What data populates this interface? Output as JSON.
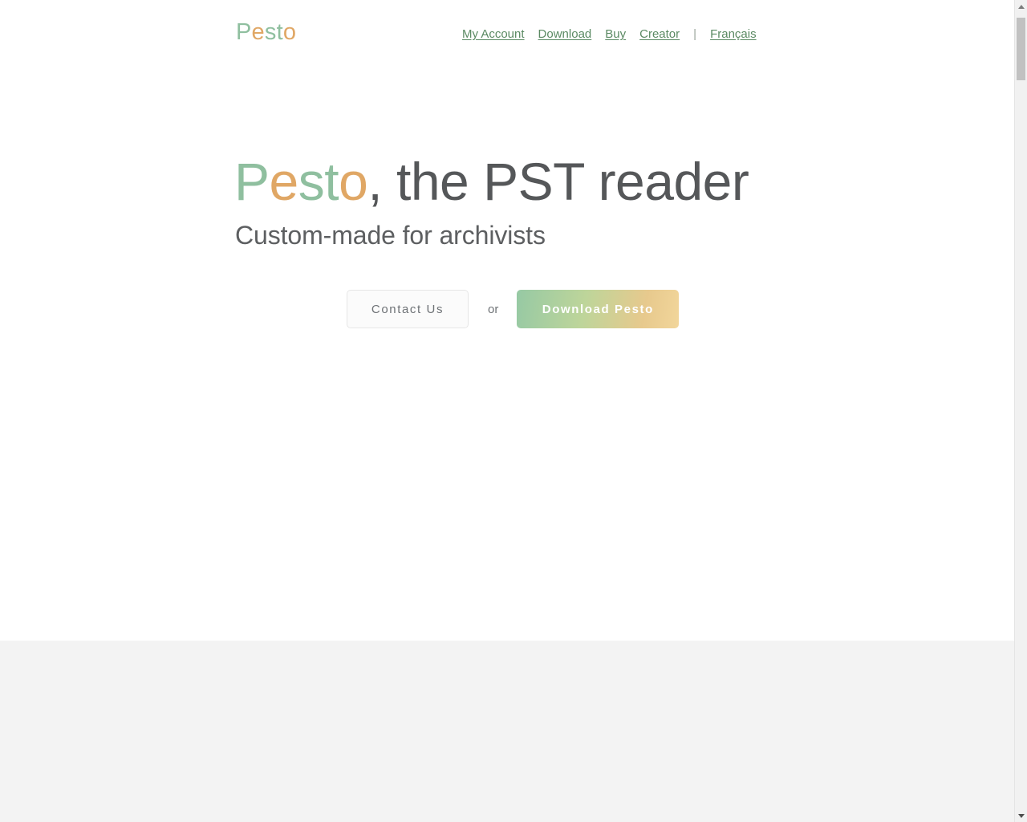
{
  "page": {
    "background_color": "#ffffff",
    "accent_green": "#8fbf9f",
    "accent_orange": "#e0a765",
    "link_green": "#5b8a63",
    "heading_gray": "#555759",
    "grey_band_color": "#f3f3f3"
  },
  "header": {
    "brand": {
      "full_text": "Pesto",
      "letters": [
        {
          "char": "P",
          "color": "#8fbf9f"
        },
        {
          "char": "e",
          "color": "#e0a765"
        },
        {
          "char": "s",
          "color": "#8fbf9f"
        },
        {
          "char": "t",
          "color": "#8fbf9f"
        },
        {
          "char": "o",
          "color": "#e0a765"
        }
      ]
    },
    "nav": {
      "items": [
        {
          "label": "My Account"
        },
        {
          "label": "Download"
        },
        {
          "label": "Buy"
        },
        {
          "label": "Creator"
        }
      ],
      "separator": "|",
      "language": {
        "label": "Français"
      }
    }
  },
  "hero": {
    "title": {
      "brand_letters": [
        {
          "char": "P",
          "color": "#8fbf9f"
        },
        {
          "char": "e",
          "color": "#e0a765"
        },
        {
          "char": "s",
          "color": "#8fbf9f"
        },
        {
          "char": "t",
          "color": "#8fbf9f"
        },
        {
          "char": "o",
          "color": "#e0a765"
        }
      ],
      "rest": ", the PST reader",
      "full_text": "Pesto, the PST reader"
    },
    "subtitle": "Custom-made for archivists",
    "actions": {
      "contact_label": "Contact Us",
      "or_label": "or",
      "download_label": "Download Pesto",
      "download_gradient_from": "#96c9a4",
      "download_gradient_to": "#f2d69b"
    }
  },
  "scrollbar": {
    "up_arrow": "scroll-up-arrow",
    "down_arrow": "scroll-down-arrow"
  }
}
